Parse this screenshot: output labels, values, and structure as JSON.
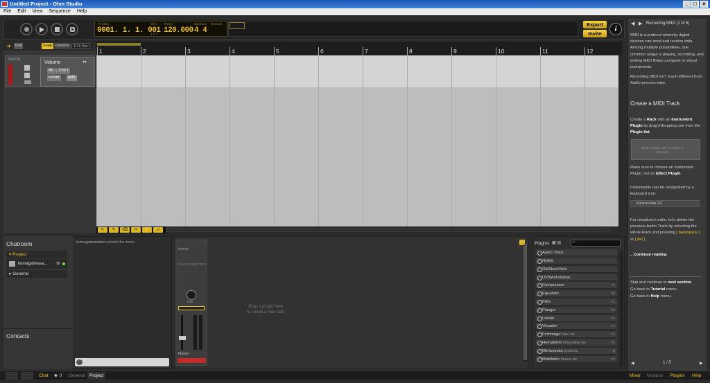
{
  "window": {
    "title": "Untitled Project - Ohm Studio"
  },
  "menu": [
    "File",
    "Edit",
    "View",
    "Sequence",
    "Help"
  ],
  "transport": {
    "position_label": "Position",
    "position": "0001. 1. 1. 001",
    "click_label": "Click",
    "click_value": "1 2 4",
    "tempo_label": "Tempo",
    "tempo": "120.000",
    "signature_label": "Signature",
    "signature": "4 4",
    "network_label": "Network",
    "bar_label": "Bar",
    "beat_label": "Beat"
  },
  "actions": {
    "export": "Export",
    "invite": "Invite",
    "info": "i"
  },
  "track_header": {
    "edit": "Edit",
    "snap": "Snap",
    "relative": "Relative",
    "grid": "1/16 Bar"
  },
  "track": {
    "volume_label": "Volume",
    "input": "All → Chn 1",
    "record_label": "record",
    "meter_label": "SOLOS",
    "auto": "auto"
  },
  "ruler": {
    "bars": [
      "1",
      "2",
      "3",
      "4",
      "5",
      "6",
      "7",
      "8",
      "9",
      "10",
      "11",
      "12"
    ]
  },
  "chat": {
    "title": "Chatroom",
    "project_label": "Project",
    "user": "kumagaimasa...",
    "general_label": "General",
    "contacts_label": "Contacts",
    "log": "kumagaimasahiro joined the room"
  },
  "rack": {
    "strip_label": "Inserts",
    "drop_small": "Drop a plugin here",
    "drop_main": "Drop a plugin here\nto create a new rack",
    "knob_label": "Gain",
    "master_label": "Master"
  },
  "plugins": {
    "title": "Plugins",
    "items": [
      {
        "name": "Audio Track",
        "sub": "",
        "tag": ""
      },
      {
        "name": "HyBrit",
        "sub": "",
        "tag": ""
      },
      {
        "name": "OldSkoolVerb",
        "sub": "",
        "tag": ""
      },
      {
        "name": "UVIWorkstation",
        "sub": "",
        "tag": ""
      },
      {
        "name": "Compressor",
        "sub": "",
        "tag": "FX"
      },
      {
        "name": "Equalizer",
        "sub": "",
        "tag": "FX"
      },
      {
        "name": "Filter",
        "sub": "",
        "tag": "FX"
      },
      {
        "name": "Flanger",
        "sub": "",
        "tag": "FX"
      },
      {
        "name": "Limiter",
        "sub": "",
        "tag": "FX"
      },
      {
        "name": "Vocoder",
        "sub": "",
        "tag": "FX"
      },
      {
        "name": "Frohmage",
        "sub": "Filter 2/2",
        "tag": "FX"
      },
      {
        "name": "Hematohm",
        "sub": "Freq Shifter 2/2",
        "tag": "FX"
      },
      {
        "name": "Minimonsta",
        "sub": "Synth 2/2",
        "tag": "|||"
      },
      {
        "name": "Mobilohm",
        "sub": "Phaser 2/2",
        "tag": "FX"
      }
    ]
  },
  "tutorial": {
    "nav": "Recording MIDI (1 of 5)",
    "p1": "MIDI is a protocol whereby digital devices can send and receive data. Among multiple possibilities, one common usage is playing, recording, and editing MIDI Notes assigned to virtual instruments.",
    "p2": "Recording MIDI isn't much different from Audio process-wise.",
    "heading": "Create a MIDI Track",
    "p3a": "Create a ",
    "p3b": "Rack",
    "p3c": " with an ",
    "p3d": "Instrument Plugin",
    "p3e": " by drag'n'dropping one from the ",
    "p3f": "Plugin list",
    "p3g": ".",
    "img_text": "Drop a plugin here to create a new rack",
    "p4a": "Make sure to choose an Instrument Plugin, not an ",
    "p4b": "Effect Plugin",
    "p4c": ".",
    "p5": "Instruments can be recognized by a keyboard icon:",
    "example": "Minimonsta 2/2",
    "p6a": "For simplicity's sake, let's delete the previous Audio Track by selecting the whole Rack and pressing ",
    "p6b": "[ backspace ]",
    "p6c": " or ",
    "p6d": "[ del ]",
    "p6e": ".",
    "continue": ".. Continue reading",
    "skip_a": "Skip and continue to ",
    "skip_b": "next section",
    "skip_c": ".",
    "back1a": "Go back to ",
    "back1b": "Tutorial",
    "back1c": " menu.",
    "back2a": "Go back to ",
    "back2b": "Help",
    "back2c": " menu.",
    "page": "1 / 5"
  },
  "bottom": {
    "chat": "Chat",
    "count": "0",
    "general": "General",
    "project": "Project",
    "mixer": "Mixer",
    "modular": "Modular",
    "plugins": "Plugins",
    "help": "Help"
  }
}
